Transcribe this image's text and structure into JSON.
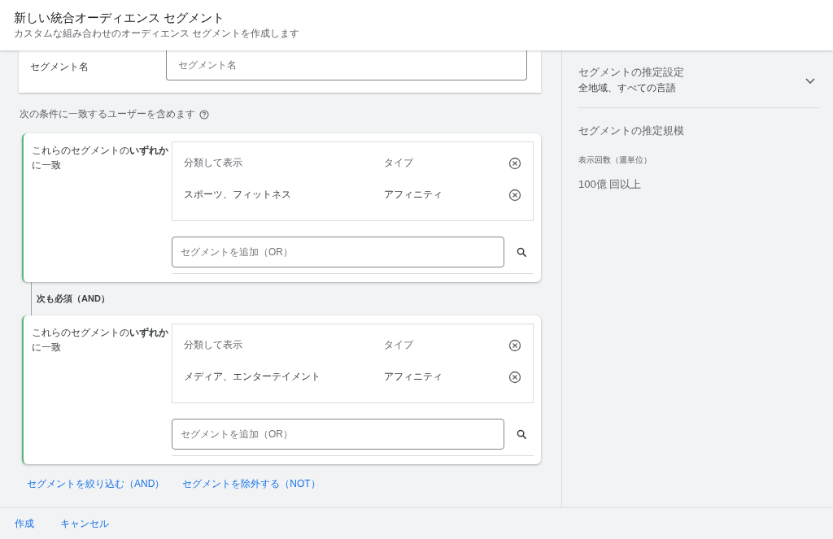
{
  "header": {
    "title": "新しい統合オーディエンス セグメント",
    "subtitle": "カスタムな組み合わせのオーディエンス セグメントを作成します"
  },
  "name_card": {
    "label": "セグメント名",
    "placeholder": "セグメント名"
  },
  "include_label": "次の条件に一致するユーザーを含めます",
  "groups": [
    {
      "condition": "これらのセグメントの**いずれか**に一致",
      "columns": [
        "分類して表示",
        "タイプ"
      ],
      "rows": [
        {
          "name": "スポーツ、フィットネス",
          "type": "アフィニティ"
        }
      ],
      "add_placeholder": "セグメントを追加（OR）"
    },
    {
      "condition": "これらのセグメントの**いずれか**に一致",
      "columns": [
        "分類して表示",
        "タイプ"
      ],
      "rows": [
        {
          "name": "メディア、エンターテイメント",
          "type": "アフィニティ"
        }
      ],
      "add_placeholder": "セグメントを追加（OR）"
    }
  ],
  "connector": "次も必須（AND）",
  "links": [
    "セグメントを絞り込む（AND）",
    "セグメントを除外する（NOT）"
  ],
  "side": {
    "settings_title": "セグメントの推定設定",
    "settings_value": "全地域、すべての言語",
    "expanded": false,
    "size_title": "セグメントの推定規模",
    "metric_label": "表示回数（週単位）",
    "metric_value": "100億 回以上"
  },
  "footer": [
    "作成",
    "キャンセル"
  ]
}
